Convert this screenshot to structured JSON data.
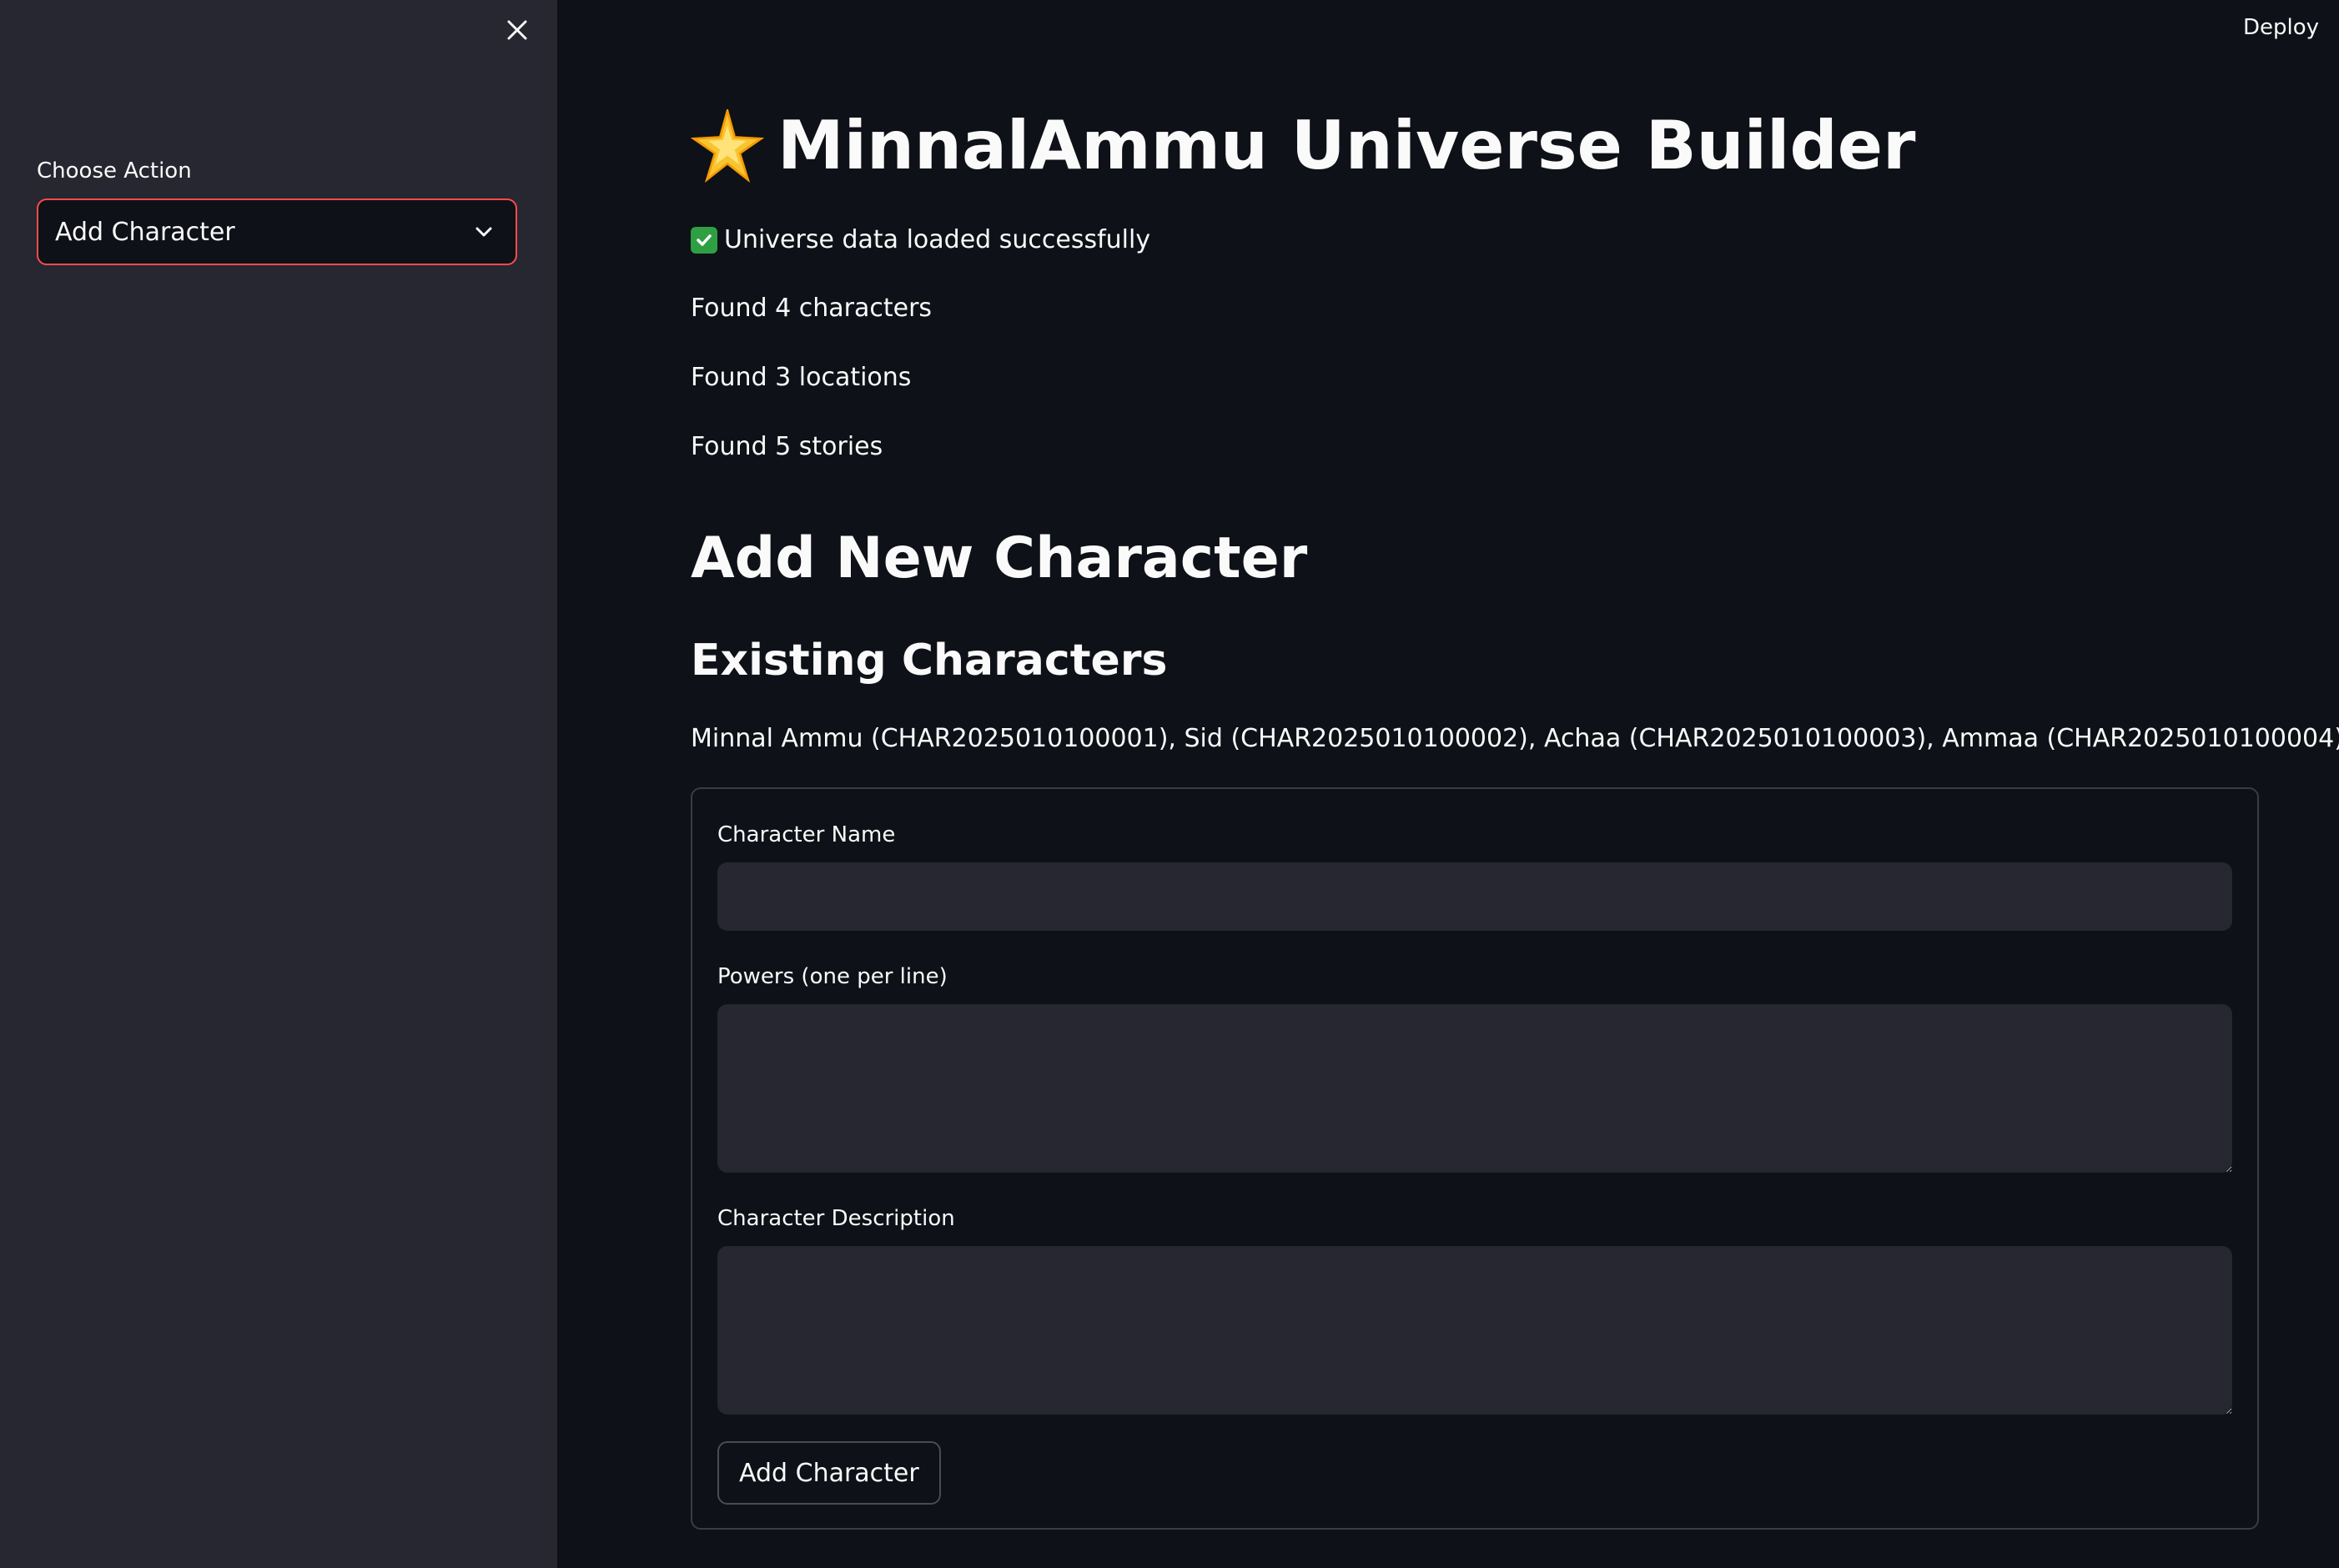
{
  "sidebar": {
    "action_label": "Choose Action",
    "action_selected": "Add Character"
  },
  "header": {
    "deploy_label": "Deploy"
  },
  "main": {
    "title": "MinnalAmmu Universe Builder",
    "title_icon": "glowing-star-icon",
    "status_message": "Universe data loaded successfully",
    "stats": [
      "Found 4 characters",
      "Found 3 locations",
      "Found 5 stories"
    ],
    "section_title": "Add New Character",
    "existing_title": "Existing Characters",
    "existing_list": "Minnal Ammu (CHAR2025010100001), Sid (CHAR2025010100002), Achaa (CHAR2025010100003), Ammaa (CHAR2025010100004)"
  },
  "form": {
    "name_label": "Character Name",
    "name_value": "",
    "powers_label": "Powers (one per line)",
    "powers_value": "",
    "description_label": "Character Description",
    "description_value": "",
    "submit_label": "Add Character"
  },
  "colors": {
    "accent": "#ff4b4b",
    "background": "#0e1117",
    "sidebar": "#262730",
    "success": "#2ea043"
  }
}
